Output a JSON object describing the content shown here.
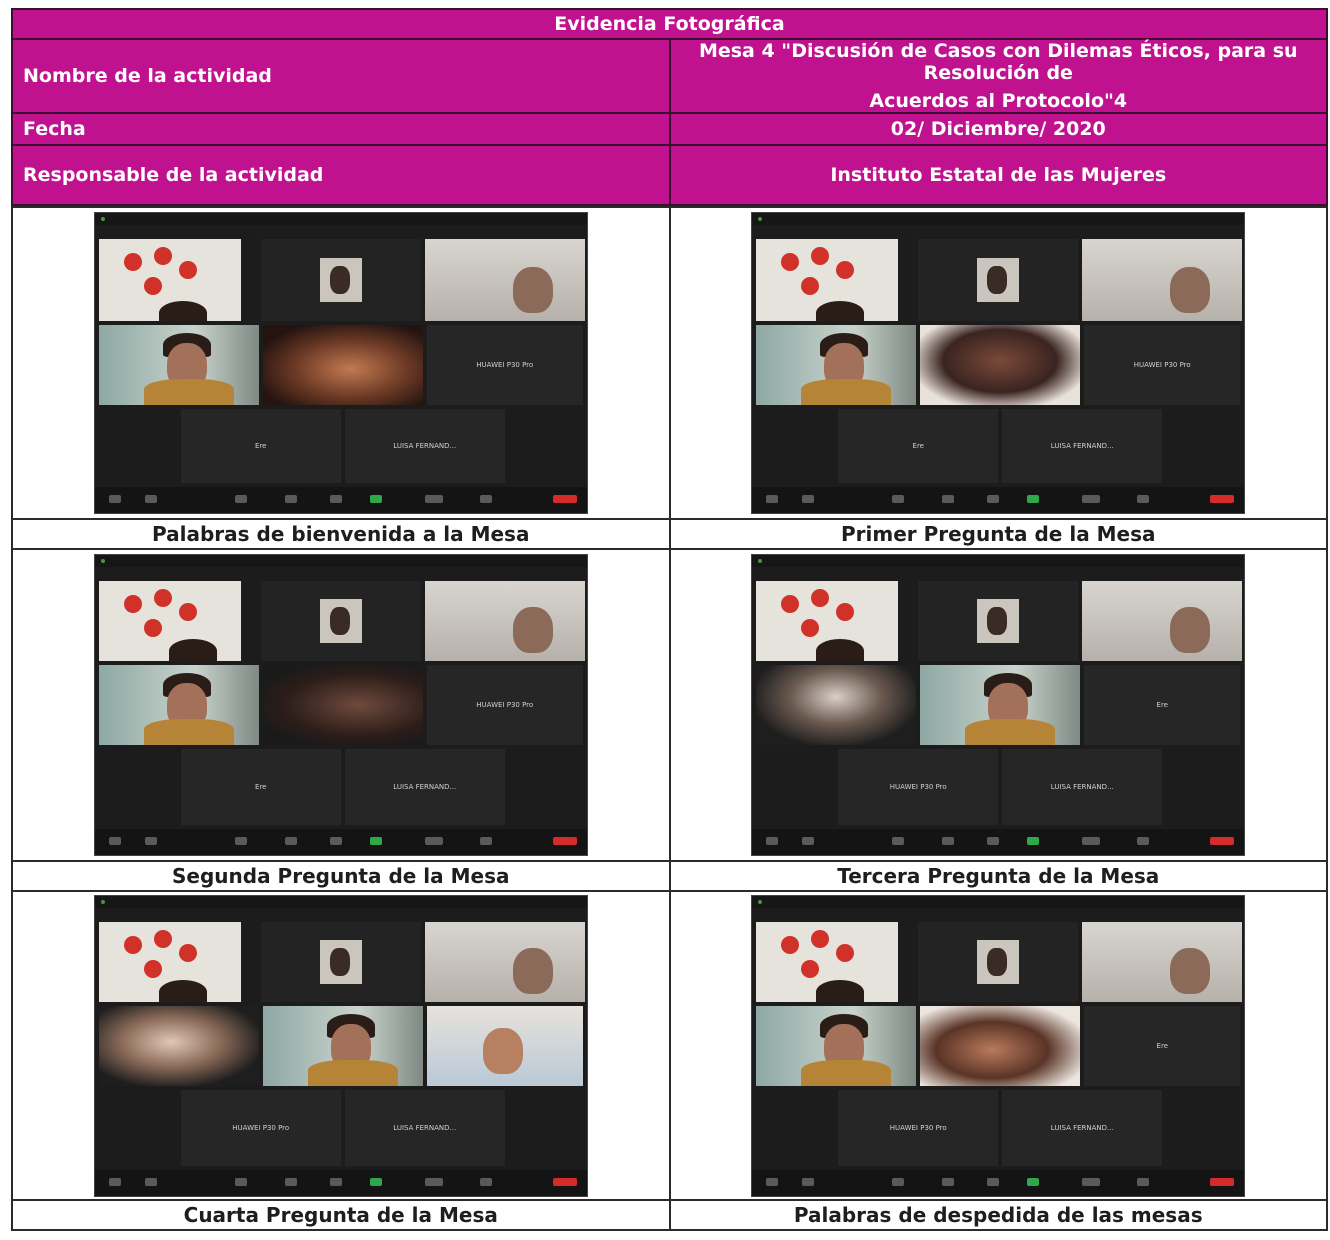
{
  "header": {
    "title": "Evidencia Fotográfica",
    "rows": [
      {
        "label": "Nombre de la actividad",
        "value_line1": "Mesa 4 \"Discusión de Casos con Dilemas Éticos, para su Resolución de",
        "value_line2": "Acuerdos al Protocolo\"4"
      },
      {
        "label": "Fecha",
        "value_line1": "02/ Diciembre/ 2020"
      },
      {
        "label": "Responsable de la actividad",
        "value_line1": "Instituto Estatal de las Mujeres"
      }
    ]
  },
  "photos": [
    {
      "caption": "Palabras de bienvenida a la Mesa",
      "tiles": [
        "HUAWEI P30 Pro",
        "Ere",
        "LUISA FERNAND..."
      ]
    },
    {
      "caption": "Primer Pregunta de la Mesa",
      "tiles": [
        "HUAWEI P30 Pro",
        "Ere",
        "LUISA FERNAND..."
      ]
    },
    {
      "caption": "Segunda Pregunta de la Mesa",
      "tiles": [
        "HUAWEI P30 Pro",
        "Ere",
        "LUISA FERNAND..."
      ]
    },
    {
      "caption": "Tercera Pregunta de la Mesa",
      "tiles": [
        "Ere",
        "HUAWEI P30 Pro",
        "LUISA FERNAND..."
      ]
    },
    {
      "caption": "Cuarta Pregunta de la Mesa",
      "tiles": [
        "HUAWEI P30 Pro",
        "LUISA FERNAND..."
      ]
    },
    {
      "caption": "Palabras de despedida de las mesas",
      "tiles": [
        "Ere",
        "HUAWEI P30 Pro",
        "LUISA FERNAND..."
      ]
    }
  ]
}
